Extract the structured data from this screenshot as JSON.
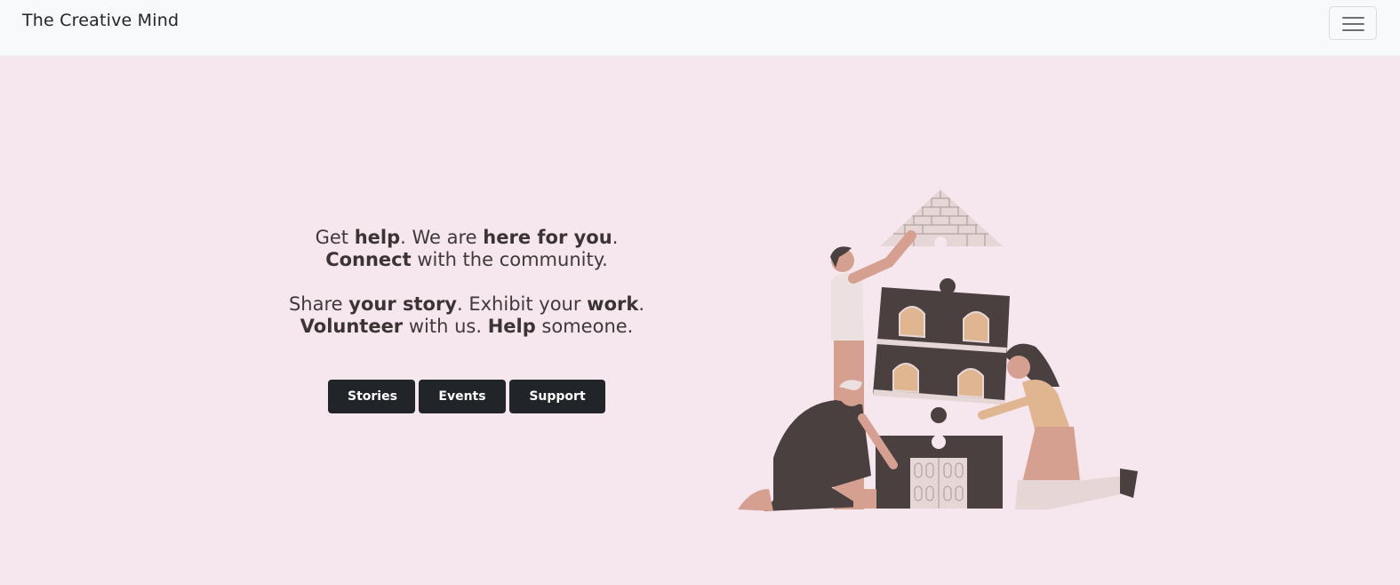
{
  "navbar": {
    "brand": "The Creative Mind",
    "toggle_icon": "hamburger-menu-icon"
  },
  "hero": {
    "line1": [
      "Get ",
      "help",
      ". We are ",
      "here for you",
      "."
    ],
    "line2": [
      "Connect",
      " with the community."
    ],
    "line3": [
      "Share ",
      "your story",
      ". Exhibit your ",
      "work",
      "."
    ],
    "line4": [
      "Volunteer",
      " with us. ",
      "Help",
      " someone."
    ]
  },
  "buttons": {
    "stories": "Stories",
    "events": "Events",
    "support": "Support"
  },
  "colors": {
    "background": "#f6e6ee",
    "navbar": "#f8f9fa",
    "button": "#212529",
    "text": "#3e3a3a"
  },
  "illustration": "people-assembling-house-puzzle-illustration"
}
